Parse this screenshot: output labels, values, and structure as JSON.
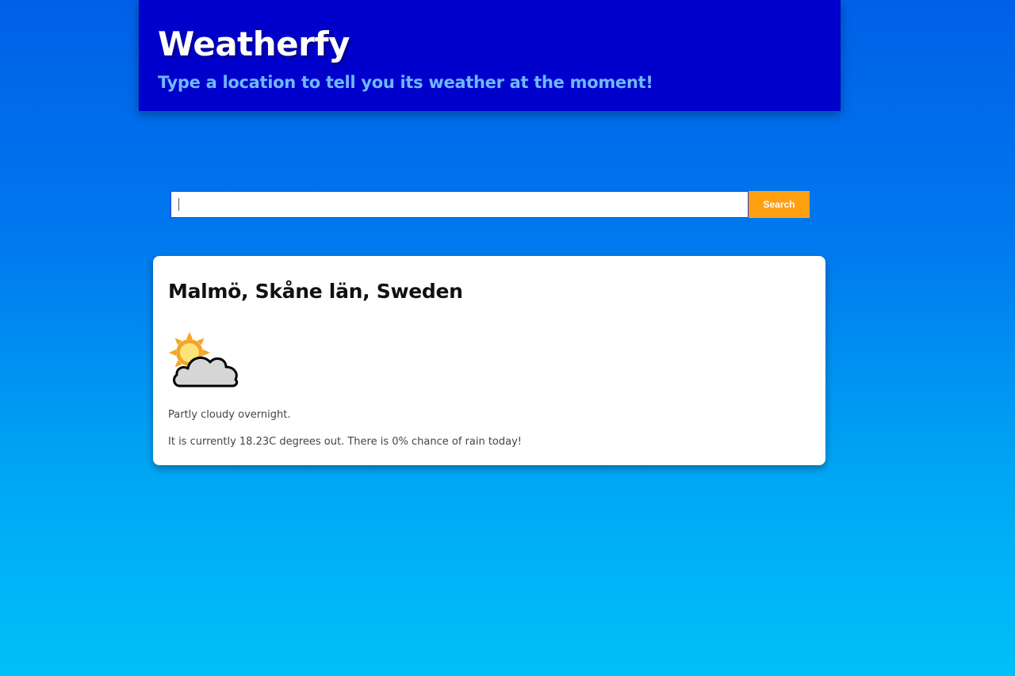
{
  "header": {
    "title": "Weatherfy",
    "subtitle": "Type a location to tell you its weather at the moment!"
  },
  "search": {
    "value": "",
    "placeholder": "",
    "button_label": "Search"
  },
  "result": {
    "location": "Malmö, Skåne län, Sweden",
    "icon": "partly-cloudy-day-icon",
    "summary": "Partly cloudy overnight.",
    "detail": "It is currently 18.23C degrees out. There is 0% chance of rain today!"
  },
  "colors": {
    "header_bg": "#0000cc",
    "subtitle": "#6fb8ff",
    "button_bg": "#ffa010",
    "gradient_top": "#0060e8",
    "gradient_bottom": "#00c0f9"
  }
}
